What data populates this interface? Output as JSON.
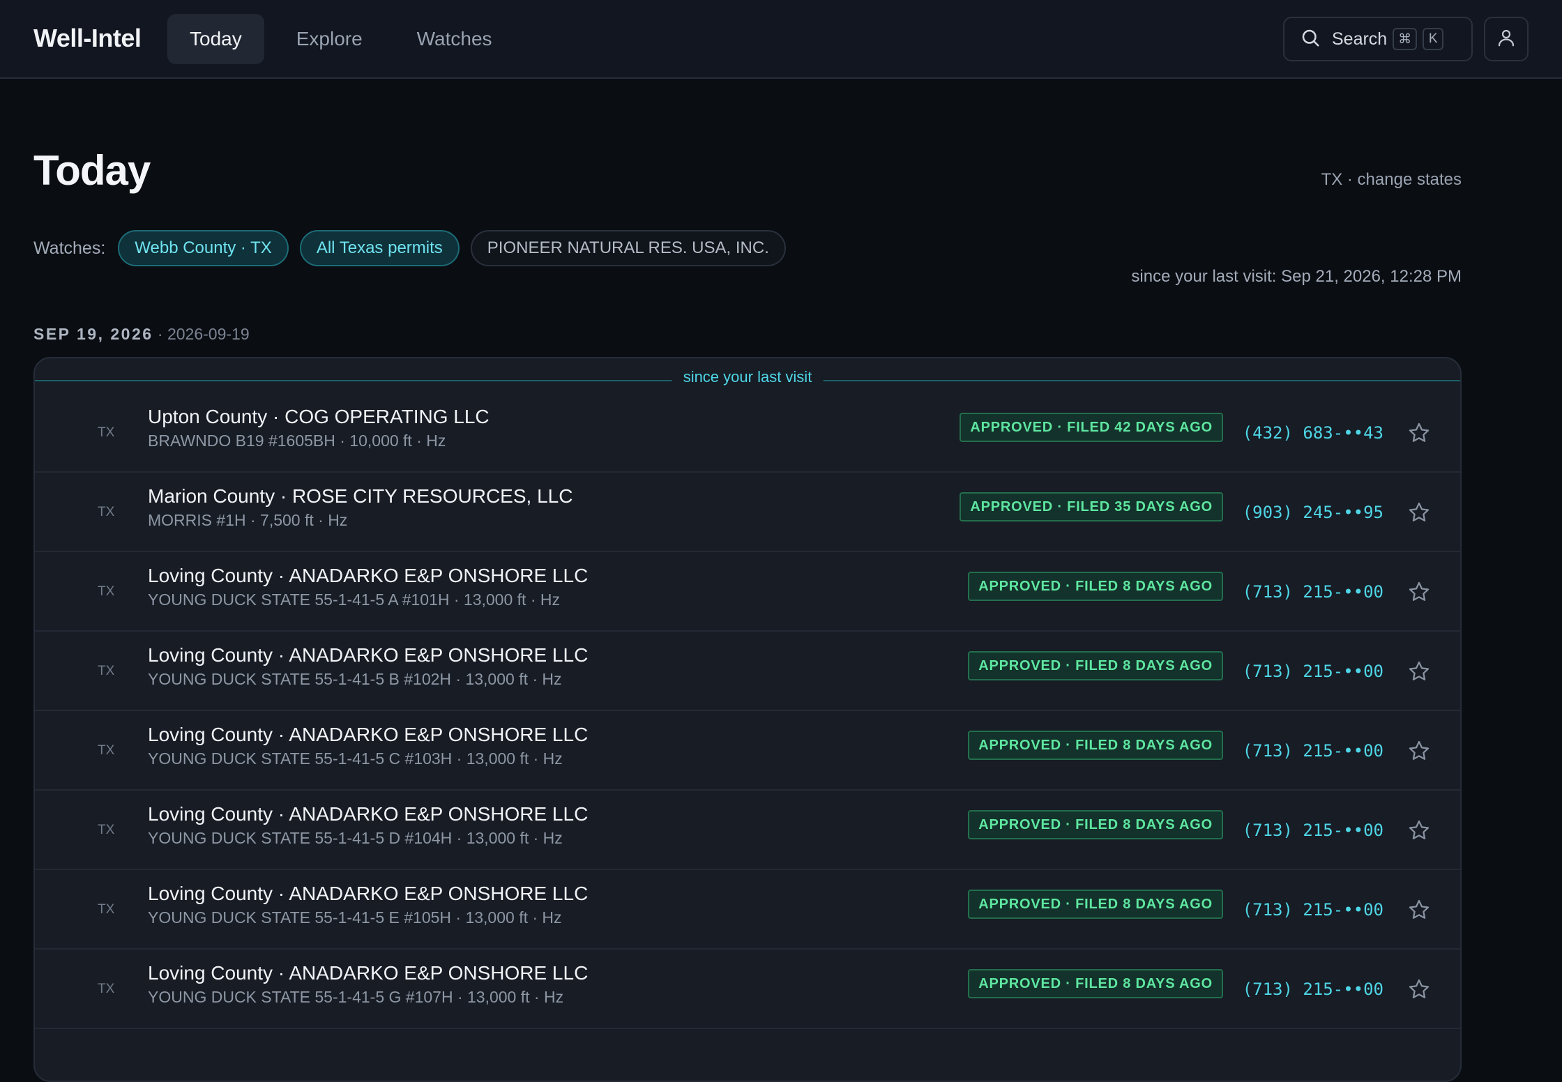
{
  "app": {
    "brand": "Well-Intel"
  },
  "nav": [
    {
      "label": "Today",
      "active": true
    },
    {
      "label": "Explore",
      "active": false
    },
    {
      "label": "Watches",
      "active": false
    }
  ],
  "search": {
    "label": "Search",
    "keys": [
      "⌘",
      "K"
    ],
    "icon": "search-icon"
  },
  "user": {
    "icon": "user-icon"
  },
  "page": {
    "title": "Today",
    "state_link": "TX · change states",
    "watches_label": "Watches:",
    "watches": [
      {
        "label": "Webb County · TX",
        "active": true
      },
      {
        "label": "All Texas permits",
        "active": true
      },
      {
        "label": "PIONEER NATURAL RES. USA, INC.",
        "active": false
      }
    ],
    "since_last_visit": "since your last visit: Sep 21, 2026, 12:28 PM"
  },
  "group": {
    "date_label": "SEP 19, 2026",
    "date_iso": "· 2026-09-19",
    "divider_label": "since your last visit",
    "rows": [
      {
        "state": "TX",
        "title": "Upton County · COG OPERATING LLC",
        "sub": "BRAWNDO B19 #1605BH · 10,000 ft · Hz",
        "status": "APPROVED · FILED 42 DAYS AGO",
        "phone": "(432) 683-••43"
      },
      {
        "state": "TX",
        "title": "Marion County · ROSE CITY RESOURCES, LLC",
        "sub": "MORRIS #1H · 7,500 ft · Hz",
        "status": "APPROVED · FILED 35 DAYS AGO",
        "phone": "(903) 245-••95"
      },
      {
        "state": "TX",
        "title": "Loving County · ANADARKO E&P ONSHORE LLC",
        "sub": "YOUNG DUCK STATE 55-1-41-5 A #101H · 13,000 ft · Hz",
        "status": "APPROVED · FILED 8 DAYS AGO",
        "phone": "(713) 215-••00"
      },
      {
        "state": "TX",
        "title": "Loving County · ANADARKO E&P ONSHORE LLC",
        "sub": "YOUNG DUCK STATE 55-1-41-5 B #102H · 13,000 ft · Hz",
        "status": "APPROVED · FILED 8 DAYS AGO",
        "phone": "(713) 215-••00"
      },
      {
        "state": "TX",
        "title": "Loving County · ANADARKO E&P ONSHORE LLC",
        "sub": "YOUNG DUCK STATE 55-1-41-5 C #103H · 13,000 ft · Hz",
        "status": "APPROVED · FILED 8 DAYS AGO",
        "phone": "(713) 215-••00"
      },
      {
        "state": "TX",
        "title": "Loving County · ANADARKO E&P ONSHORE LLC",
        "sub": "YOUNG DUCK STATE 55-1-41-5 D #104H · 13,000 ft · Hz",
        "status": "APPROVED · FILED 8 DAYS AGO",
        "phone": "(713) 215-••00"
      },
      {
        "state": "TX",
        "title": "Loving County · ANADARKO E&P ONSHORE LLC",
        "sub": "YOUNG DUCK STATE 55-1-41-5 E #105H · 13,000 ft · Hz",
        "status": "APPROVED · FILED 8 DAYS AGO",
        "phone": "(713) 215-••00"
      },
      {
        "state": "TX",
        "title": "Loving County · ANADARKO E&P ONSHORE LLC",
        "sub": "YOUNG DUCK STATE 55-1-41-5 G #107H · 13,000 ft · Hz",
        "status": "APPROVED · FILED 8 DAYS AGO",
        "phone": "(713) 215-••00"
      }
    ]
  },
  "colors": {
    "accent_cyan": "#4fd6e6",
    "status_green": "#5ee6a0",
    "background": "#0a0d12",
    "card": "#171c25"
  }
}
